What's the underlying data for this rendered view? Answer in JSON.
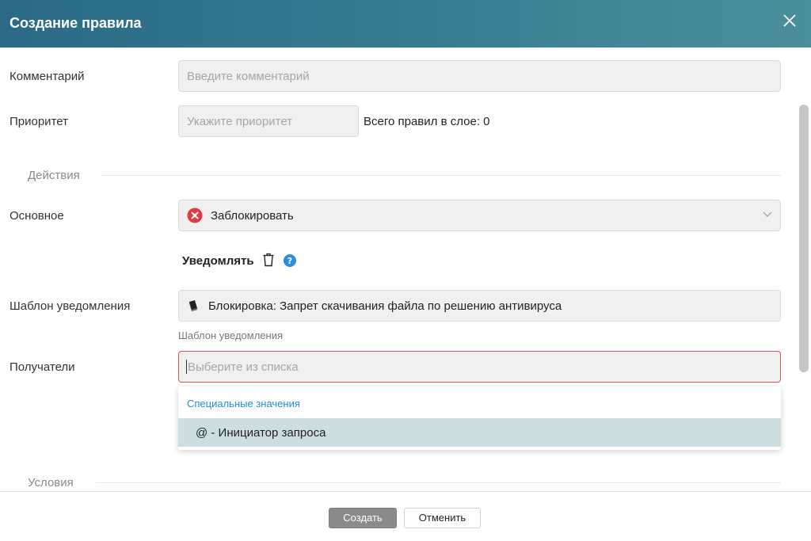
{
  "dialog": {
    "title": "Создание правила",
    "close_icon": "close-icon"
  },
  "form": {
    "comment": {
      "label": "Комментарий",
      "placeholder": "Введите комментарий"
    },
    "priority": {
      "label": "Приоритет",
      "placeholder": "Укажите приоритет",
      "total_rules": "Всего правил в слое: 0"
    },
    "actions_section": "Действия",
    "main_action": {
      "label": "Основное",
      "value": "Заблокировать",
      "icon": "blocked-icon"
    },
    "notify": {
      "label": "Уведомлять",
      "delete_icon": "trash-icon",
      "help_icon": "help-icon"
    },
    "notification_template": {
      "label": "Шаблон уведомления",
      "value": "Блокировка: Запрет скачивания файла по решению антивируса",
      "hint": "Шаблон уведомления",
      "icon": "book-icon"
    },
    "recipients": {
      "label": "Получатели",
      "placeholder": "Выберите из списка"
    },
    "recipients_dropdown": {
      "group_label": "Специальные значения",
      "options": [
        {
          "label": "@ - Инициатор запроса"
        }
      ]
    },
    "conditions_section": "Условия"
  },
  "footer": {
    "create_label": "Создать",
    "cancel_label": "Отменить"
  },
  "colors": {
    "header_start": "#2a6a85",
    "header_end": "#4b8f9d",
    "error_border": "#e0505a",
    "block_icon": "#e13a44",
    "help_icon": "#2a8ed8",
    "link_blue": "#1e8fd3",
    "option_highlight": "#cddde0"
  }
}
